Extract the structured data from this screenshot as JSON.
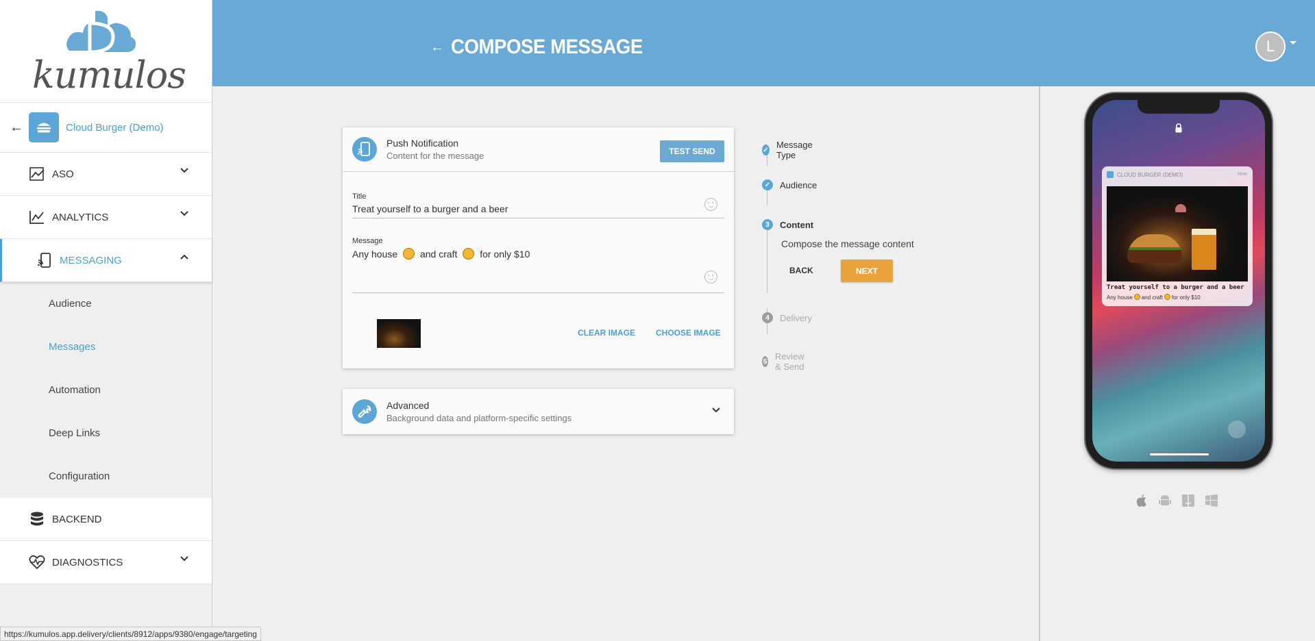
{
  "brand": {
    "logo_text": "kumulos",
    "accent": "#69a9d6",
    "highlight": "#e8a33a"
  },
  "sidebar": {
    "app_name": "Cloud Burger (Demo)",
    "nav": [
      {
        "label": "ASO",
        "icon": "trending-icon"
      },
      {
        "label": "ANALYTICS",
        "icon": "chart-line-icon"
      },
      {
        "label": "MESSAGING",
        "icon": "phone-cast-icon"
      },
      {
        "label": "BACKEND",
        "icon": "database-icon"
      },
      {
        "label": "DIAGNOSTICS",
        "icon": "heart-pulse-icon"
      }
    ],
    "messaging_sub": [
      "Audience",
      "Messages",
      "Automation",
      "Deep Links",
      "Configuration"
    ]
  },
  "header": {
    "title": "COMPOSE MESSAGE",
    "avatar_initial": "L"
  },
  "push_card": {
    "title": "Push Notification",
    "subtitle": "Content for the message",
    "test_send": "TEST SEND",
    "title_label": "Title",
    "title_value": "Treat yourself to a  burger and a beer",
    "message_label": "Message",
    "message_part1": "Any house",
    "message_part2": "and craft",
    "message_part3": "for only $10",
    "clear_image": "CLEAR IMAGE",
    "choose_image": "CHOOSE IMAGE"
  },
  "advanced_card": {
    "title": "Advanced",
    "subtitle": "Background data and platform-specific settings"
  },
  "stepper": {
    "steps": [
      {
        "num": "1",
        "label": "Message Type",
        "state": "done"
      },
      {
        "num": "2",
        "label": "Audience",
        "state": "done"
      },
      {
        "num": "3",
        "label": "Content",
        "state": "active"
      },
      {
        "num": "4",
        "label": "Delivery",
        "state": "pending"
      },
      {
        "num": "5",
        "label": "Review & Send",
        "state": "pending"
      }
    ],
    "content_description": "Compose the message content",
    "back": "BACK",
    "next": "NEXT"
  },
  "preview": {
    "app_label": "CLOUD BURGER (DEMO)",
    "time": "Now",
    "title": "Treat yourself to a burger and a beer",
    "msg_part1": "Any house",
    "msg_part2": "and craft",
    "msg_part3": "for only $10",
    "platforms": [
      "apple-icon",
      "android-icon",
      "finder-icon",
      "windows-icon"
    ]
  },
  "status_url": "https://kumulos.app.delivery/clients/8912/apps/9380/engage/targeting"
}
